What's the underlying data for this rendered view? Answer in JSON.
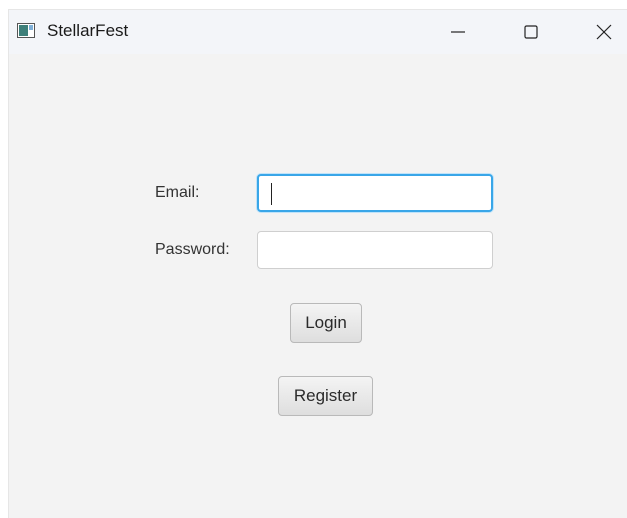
{
  "window": {
    "title": "StellarFest",
    "controls": {
      "minimize_icon": "minimize-icon",
      "maximize_icon": "maximize-icon",
      "close_icon": "close-icon"
    }
  },
  "form": {
    "email_label": "Email:",
    "email_value": "",
    "password_label": "Password:",
    "password_value": "",
    "login_label": "Login",
    "register_label": "Register"
  },
  "colors": {
    "window_bg": "#f3f3f3",
    "focus_border": "#39a6e8",
    "button_border": "#b9b9b9"
  }
}
